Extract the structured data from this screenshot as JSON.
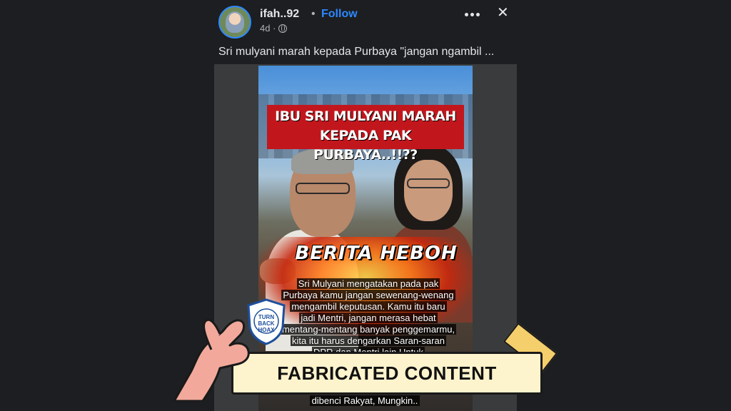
{
  "post": {
    "username": "ifah..92",
    "separator": "•",
    "follow_label": "Follow",
    "time": "4d ·",
    "caption": "Sri mulyani marah kepada Purbaya \"jangan ngambil ..."
  },
  "header": {
    "more_icon": "more-horizontal-icon",
    "close_symbol": "✕"
  },
  "media": {
    "headline_line1": "IBU SRI MULYANI MARAH",
    "headline_line2": "KEPADA PAK PURBAYA..!!??",
    "burst_label": "BERITA HEBOH",
    "subtext_lines": [
      "Sri Mulyani mengatakan pada pak",
      "Purbaya kamu jangan sewenang-wenang",
      "mengambil keputusan. Kamu itu baru",
      "jadi Mentri, jangan merasa hebat",
      "mentang-mentang banyak penggemarmu,",
      "kita itu harus dengarkan Saran-saran",
      "DPR dan Mentri lain Untuk"
    ],
    "bottom_line": "dibenci Rakyat, Mungkin.."
  },
  "overlay": {
    "badge_text": "TURN\nBACK\nHOAX",
    "badge_ring_text": "MASYARAKAT ANTI FITNAH INDONESIA • MAFINDO",
    "banner_label": "FABRICATED CONTENT",
    "colors": {
      "banner_bg": "#fdf3cc",
      "tape": "#f5cf6b",
      "skin": "#f2a99b",
      "badge_blue": "#1d4f9c",
      "follow_blue": "#2d88ff",
      "headline_red": "#c2161d"
    }
  }
}
